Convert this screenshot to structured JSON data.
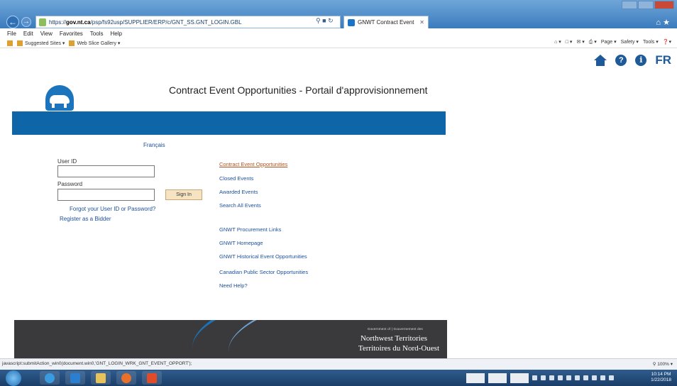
{
  "browser": {
    "url_prefix": "https://",
    "url_domain": "gov.nt.ca",
    "url_rest": "/psp/fs92usp/SUPPLIER/ERP/c/GNT_SS.GNT_LOGIN.GBL",
    "tab_title": "GNWT Contract Event",
    "menu": [
      "File",
      "Edit",
      "View",
      "Favorites",
      "Tools",
      "Help"
    ],
    "favorites": [
      "Suggested Sites ▾",
      "Web Slice Gallery ▾"
    ],
    "commands": [
      "Page ▾",
      "Safety ▾",
      "Tools ▾"
    ],
    "status_text": "javascript:submitAction_win0(document.win0,'GNT_LOGIN_WRK_GNT_EVENT_OPPORT');",
    "zoom": "100%"
  },
  "header": {
    "lang_toggle": "FR",
    "title": "Contract Event Opportunities - Portail d'approvisionnement"
  },
  "login": {
    "francais_link": "Français",
    "user_id_label": "User ID",
    "password_label": "Password",
    "sign_in": "Sign In",
    "forgot": "Forgot your User ID or Password?",
    "register": "Register as a Bidder"
  },
  "links": {
    "contract_events": "Contract Event Opportunities",
    "closed_events": "Closed Events",
    "awarded_events": "Awarded Events",
    "search_all": "Search All Events",
    "procurement_links": "GNWT Procurement Links",
    "homepage": "GNWT Homepage",
    "historical": "GNWT Historical Event Opportunities",
    "canadian": "Canadian Public Sector Opportunities",
    "need_help": "Need Help?"
  },
  "footer": {
    "gov_line": "Government of | Gouvernement des",
    "en": "Northwest Territories",
    "fr": "Territoires du Nord-Ouest"
  },
  "taskbar": {
    "time": "10:14 PM",
    "date": "1/22/2018"
  },
  "colors": {
    "banner": "#0e66a8",
    "link": "#1c4f9c",
    "active_link": "#b0531f",
    "icon_blue": "#1e5a9a"
  }
}
